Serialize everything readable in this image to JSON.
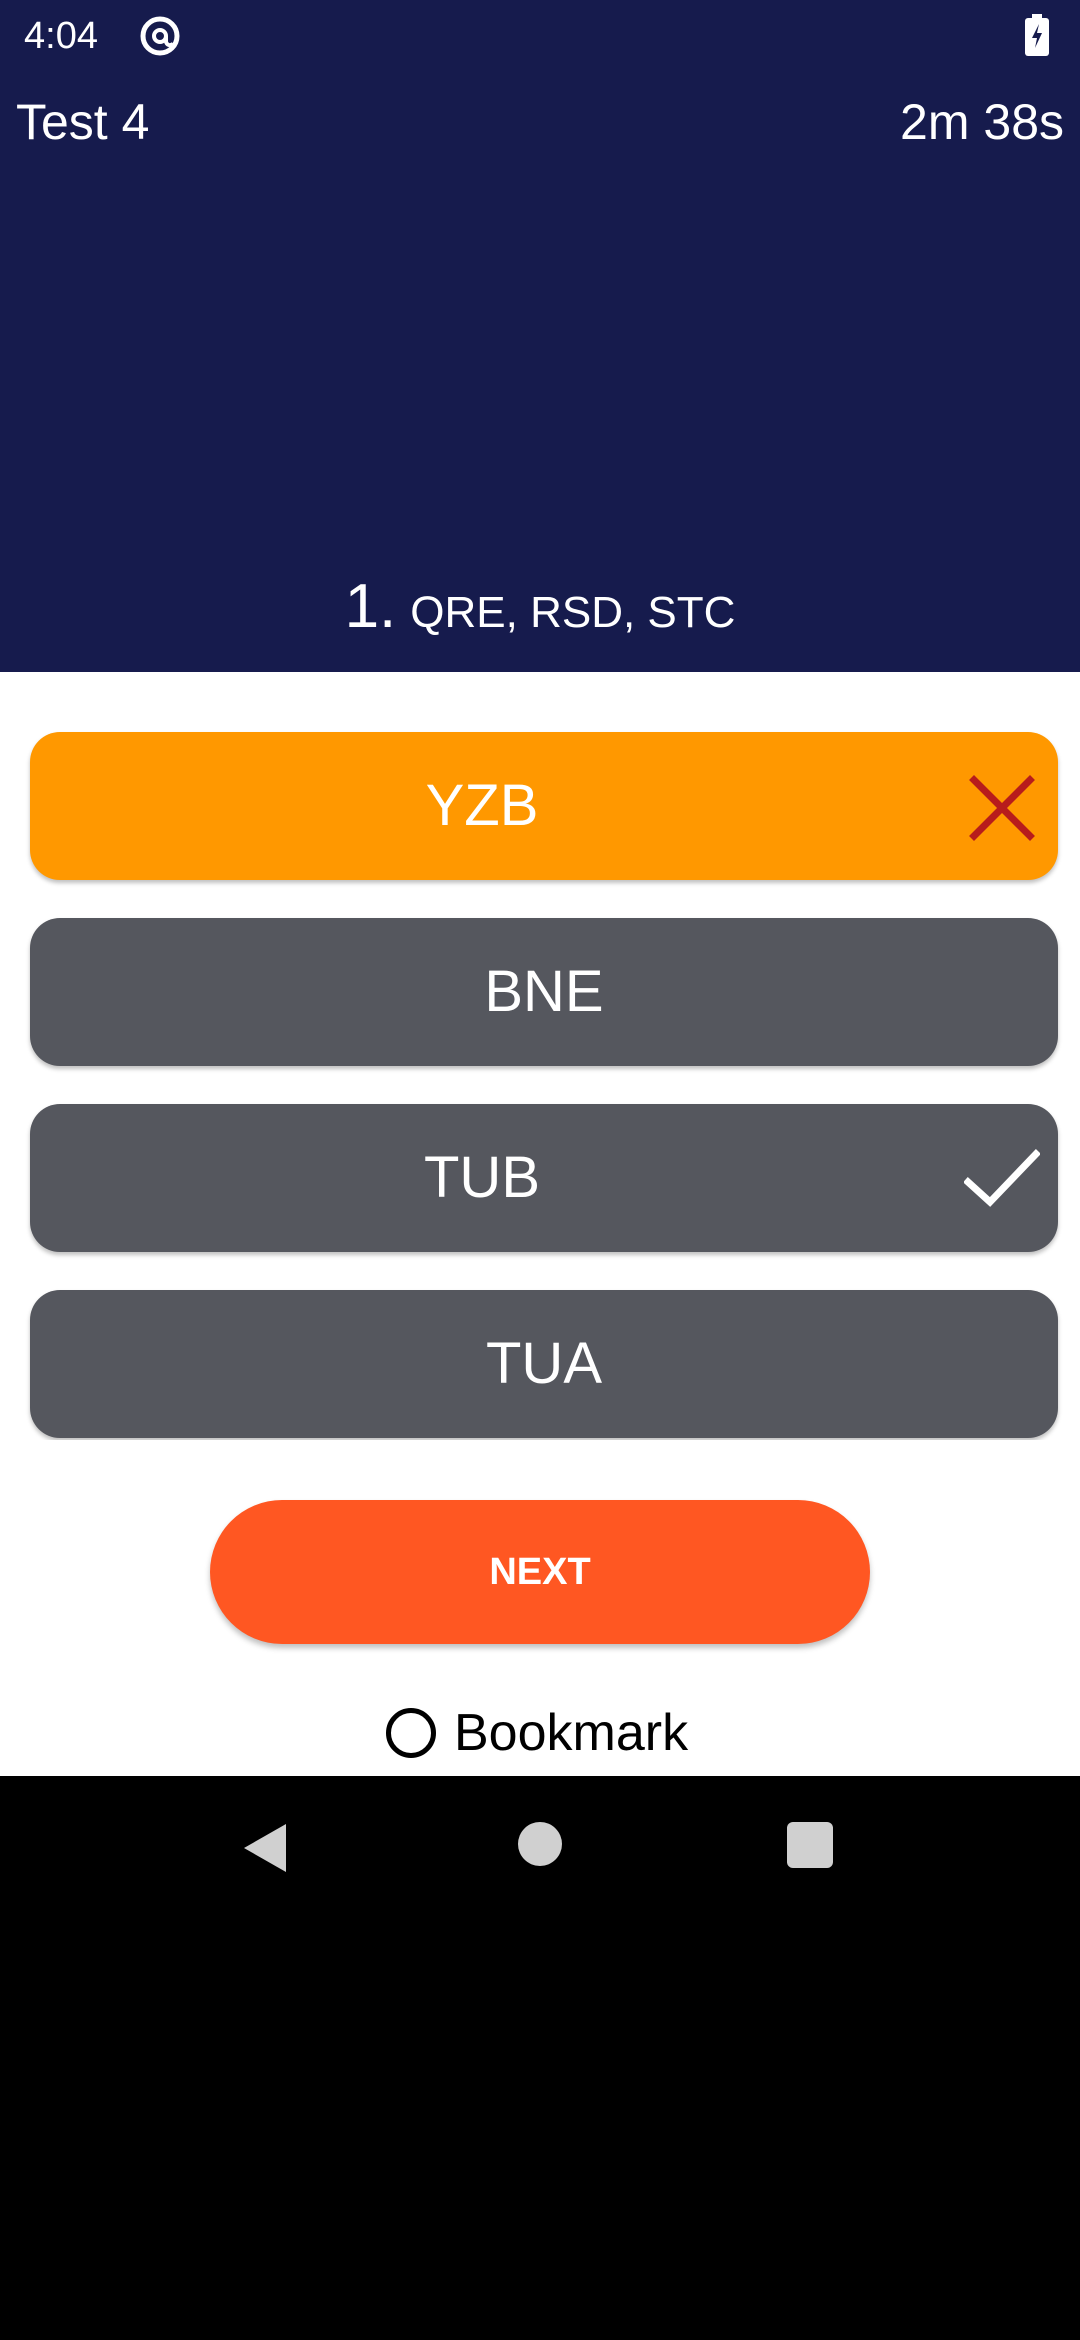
{
  "status_bar": {
    "time": "4:04",
    "app_icon": "at-sign-icon",
    "battery_icon": "battery-charging-icon"
  },
  "header": {
    "title": "Test 4",
    "timer": "2m 38s"
  },
  "question": {
    "number": "1.",
    "text": "QRE, RSD, STC"
  },
  "options": [
    {
      "label": "YZB",
      "state": "selected-wrong",
      "mark": "close-icon"
    },
    {
      "label": "BNE",
      "state": "default",
      "mark": ""
    },
    {
      "label": "TUB",
      "state": "correct",
      "mark": "check-icon"
    },
    {
      "label": "TUA",
      "state": "default",
      "mark": ""
    }
  ],
  "actions": {
    "next_label": "NEXT",
    "bookmark_label": "Bookmark",
    "bookmark_checked": false
  },
  "colors": {
    "header_bg": "#161b4d",
    "option_default": "#55575e",
    "option_wrong": "#ff9800",
    "wrong_mark": "#b71c1c",
    "next_button": "#ff5722"
  },
  "nav_bar": {
    "back_icon": "back-triangle-icon",
    "home_icon": "home-circle-icon",
    "recents_icon": "recents-square-icon"
  }
}
